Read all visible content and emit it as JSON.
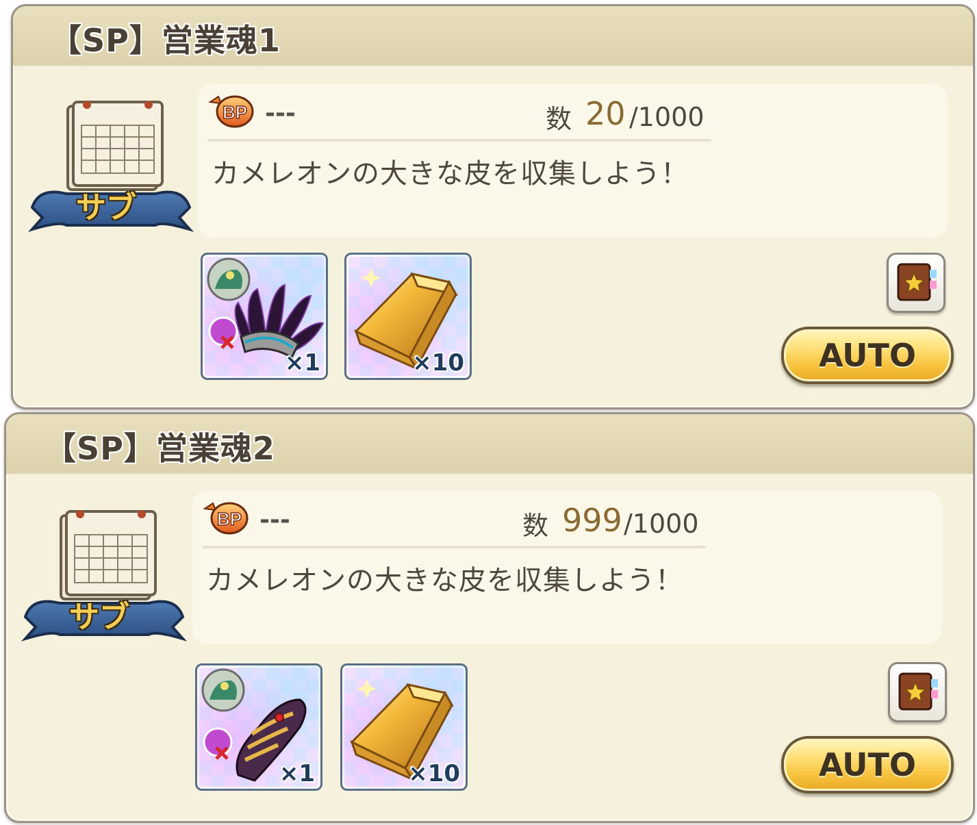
{
  "quests": [
    {
      "title": "【SP】営業魂1",
      "emblem_label": "サブ",
      "bp_value": "---",
      "count_label": "数",
      "count_current": "20",
      "count_max": "/1000",
      "description": "カメレオンの大きな皮を収集しよう！",
      "rewards": [
        {
          "icon": "feather-headdress-icon",
          "quantity": "×1"
        },
        {
          "icon": "gold-bar-icon",
          "quantity": "×10"
        }
      ],
      "book_icon": "star-book-icon",
      "auto_label": "AUTO"
    },
    {
      "title": "【SP】営業魂2",
      "emblem_label": "サブ",
      "bp_value": "---",
      "count_label": "数",
      "count_current": "999",
      "count_max": "/1000",
      "description": "カメレオンの大きな皮を収集しよう！",
      "rewards": [
        {
          "icon": "gauntlet-icon",
          "quantity": "×1"
        },
        {
          "icon": "gold-bar-icon",
          "quantity": "×10"
        }
      ],
      "book_icon": "star-book-icon",
      "auto_label": "AUTO"
    }
  ]
}
